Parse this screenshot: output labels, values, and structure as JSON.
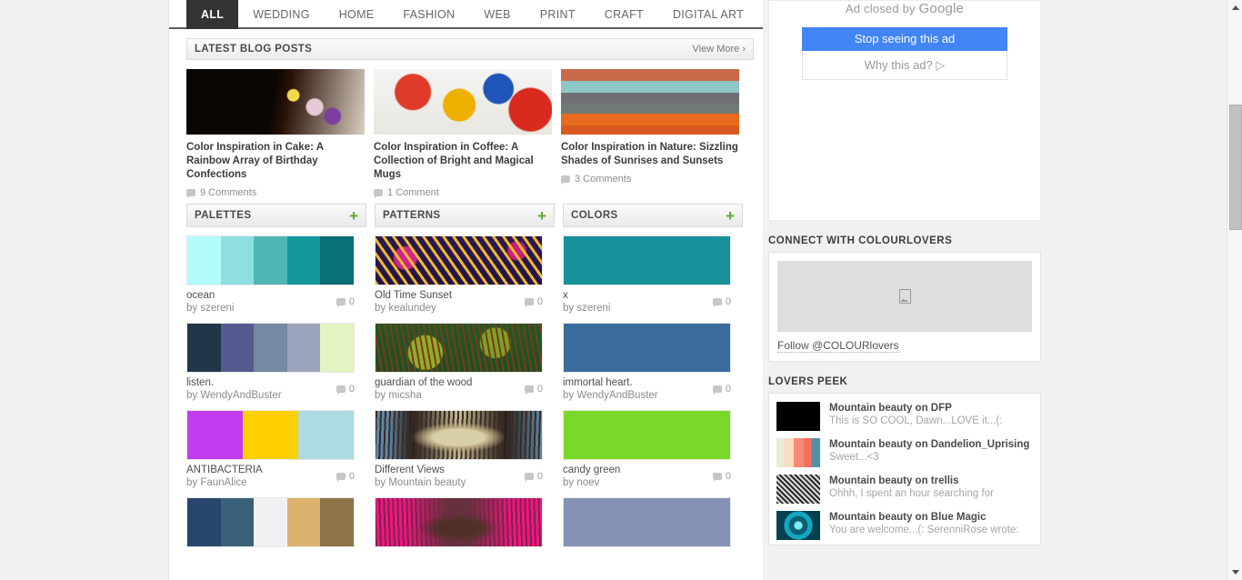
{
  "nav": {
    "items": [
      {
        "label": "ALL",
        "active": true
      },
      {
        "label": "WEDDING",
        "active": false
      },
      {
        "label": "HOME",
        "active": false
      },
      {
        "label": "FASHION",
        "active": false
      },
      {
        "label": "WEB",
        "active": false
      },
      {
        "label": "PRINT",
        "active": false
      },
      {
        "label": "CRAFT",
        "active": false
      },
      {
        "label": "DIGITAL ART",
        "active": false
      }
    ]
  },
  "blog": {
    "heading": "LATEST BLOG POSTS",
    "view_more": "View More ›",
    "posts": [
      {
        "title": "Color Inspiration in Cake: A Rainbow Array of Birthday Confections",
        "comments": "9 Comments"
      },
      {
        "title": "Color Inspiration in Coffee: A Collection of Bright and Magical Mugs",
        "comments": "1 Comment"
      },
      {
        "title": "Color Inspiration in Nature: Sizzling Shades of Sunrises and Sunsets",
        "comments": "3 Comments"
      }
    ]
  },
  "columns": [
    {
      "heading": "PALETTES",
      "add_label": "+",
      "items": [
        {
          "name": "ocean",
          "by": "by szereni",
          "comments": "0",
          "swatch": [
            "#b4fbfb",
            "#8ddfe0",
            "#4fb6b4",
            "#15989c",
            "#0b6f78"
          ]
        },
        {
          "name": "listen.",
          "by": "by WendyAndBuster",
          "comments": "0",
          "swatch": [
            "#22364a",
            "#555b91",
            "#7588a4",
            "#9ca5bd",
            "#e2f5c2"
          ]
        },
        {
          "name": "ANTIBACTERIA",
          "by": "by FaunAlice",
          "comments": "0",
          "swatch": [
            "#c33cf0",
            "#ffcf00",
            "#aedae4"
          ]
        },
        {
          "name": "",
          "by": "",
          "comments": "",
          "swatch": [
            "#28456c",
            "#3a6179",
            "#f2f0f2",
            "#dbb36e",
            "#8d7348"
          ]
        }
      ]
    },
    {
      "heading": "PATTERNS",
      "add_label": "+",
      "items": [
        {
          "name": "Old Time Sunset",
          "by": "by kealundey",
          "comments": "0"
        },
        {
          "name": "guardian of the wood",
          "by": "by micsha",
          "comments": "0"
        },
        {
          "name": "Different Views",
          "by": "by Mountain beauty",
          "comments": "0"
        },
        {
          "name": "",
          "by": "",
          "comments": ""
        }
      ]
    },
    {
      "heading": "COLORS",
      "add_label": "+",
      "items": [
        {
          "name": "x",
          "by": "by szereni",
          "comments": "0",
          "color": "#19919b"
        },
        {
          "name": "immortal heart.",
          "by": "by WendyAndBuster",
          "comments": "0",
          "color": "#3b6c9e"
        },
        {
          "name": "candy green",
          "by": "by noev",
          "comments": "0",
          "color": "#79d829"
        },
        {
          "name": "",
          "by": "",
          "comments": "",
          "color": "#8592b5"
        }
      ]
    }
  ],
  "ad": {
    "closed_text": "Ad closed by ",
    "brand": "Google",
    "stop_label": "Stop seeing this ad",
    "why_label": "Why this ad? ▷"
  },
  "connect": {
    "title": "CONNECT WITH COLOURLOVERS",
    "image_icon": "broken-image-icon",
    "follow_label": "Follow @COLOURlovers"
  },
  "lovers_peek": {
    "title": "LOVERS PEEK",
    "rows": [
      {
        "headline": "Mountain beauty on DFP",
        "snippet": "This is SO COOL, Dawn...LOVE it...(:"
      },
      {
        "headline": "Mountain beauty on Dandelion_Uprising",
        "snippet": "Sweet...<3"
      },
      {
        "headline": "Mountain beauty on trellis",
        "snippet": "Ohhh, I spent an hour searching for"
      },
      {
        "headline": "Mountain beauty on Blue Magic",
        "snippet": "You are welcome...(: SerenniRose wrote:"
      }
    ]
  },
  "colors": {
    "accent_green": "#5aa832",
    "ad_blue": "#4285f4",
    "nav_active_bg": "#333333"
  }
}
